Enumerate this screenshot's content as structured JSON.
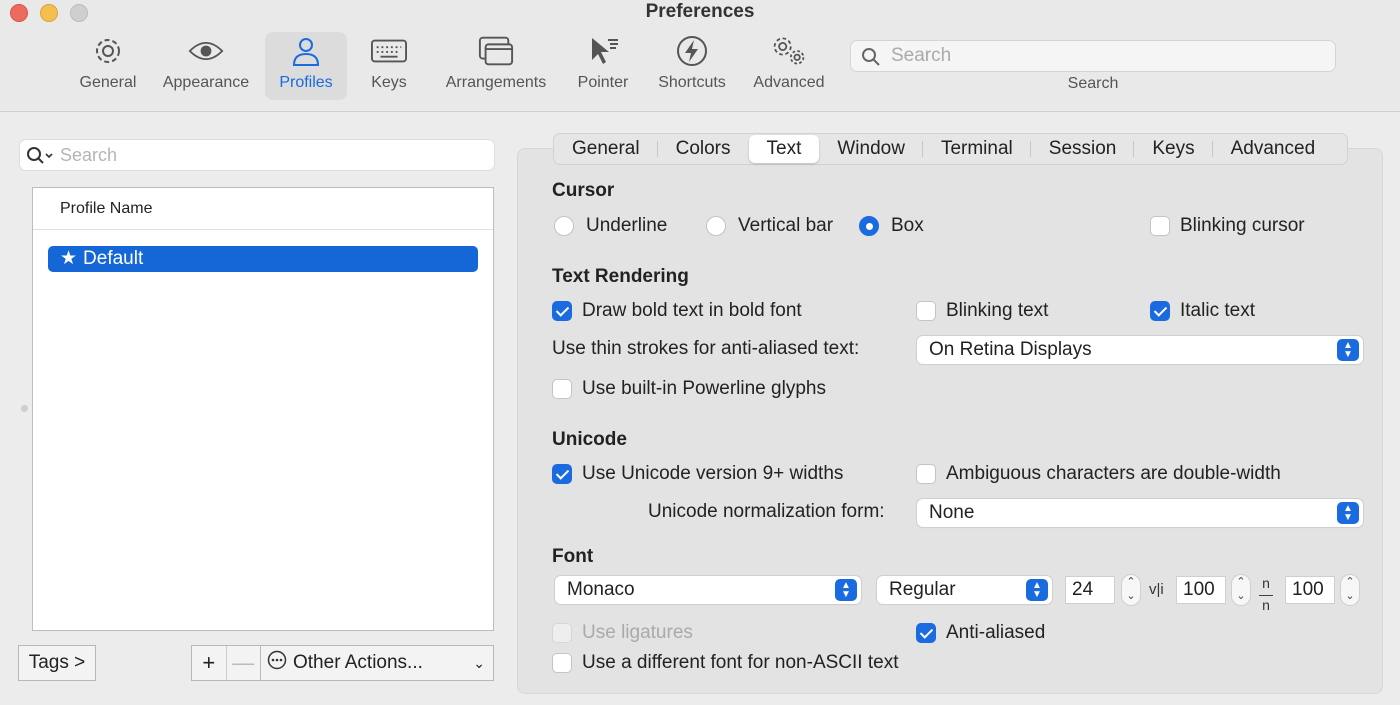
{
  "window": {
    "title": "Preferences"
  },
  "toolbar": {
    "items": [
      {
        "label": "General",
        "icon": "gear-icon"
      },
      {
        "label": "Appearance",
        "icon": "eye-icon"
      },
      {
        "label": "Profiles",
        "icon": "person-icon"
      },
      {
        "label": "Keys",
        "icon": "keyboard-icon"
      },
      {
        "label": "Arrangements",
        "icon": "windows-icon"
      },
      {
        "label": "Pointer",
        "icon": "pointer-icon"
      },
      {
        "label": "Shortcuts",
        "icon": "bolt-icon"
      },
      {
        "label": "Advanced",
        "icon": "gears-icon"
      }
    ],
    "active": "Profiles",
    "search_placeholder": "Search",
    "search_label": "Search"
  },
  "profiles": {
    "search_placeholder": "Search",
    "column_header": "Profile Name",
    "rows": [
      {
        "name": "Default",
        "starred": true
      }
    ],
    "tags_label": "Tags >",
    "add_label": "+",
    "remove_label": "—",
    "other_actions_label": "Other Actions..."
  },
  "tabs": {
    "items": [
      "General",
      "Colors",
      "Text",
      "Window",
      "Terminal",
      "Session",
      "Keys",
      "Advanced"
    ],
    "active": "Text"
  },
  "cursor": {
    "heading": "Cursor",
    "options": [
      "Underline",
      "Vertical bar",
      "Box"
    ],
    "selected": "Box",
    "blinking_label": "Blinking cursor",
    "blinking": false
  },
  "text_rendering": {
    "heading": "Text Rendering",
    "bold_label": "Draw bold text in bold font",
    "bold": true,
    "blinking_text_label": "Blinking text",
    "blinking_text": false,
    "italic_label": "Italic text",
    "italic": true,
    "thin_strokes_label": "Use thin strokes for anti-aliased text:",
    "thin_strokes_value": "On Retina Displays",
    "powerline_label": "Use built-in Powerline glyphs",
    "powerline": false
  },
  "unicode": {
    "heading": "Unicode",
    "widths_label": "Use Unicode version 9+ widths",
    "widths": true,
    "ambiguous_label": "Ambiguous characters are double-width",
    "ambiguous": false,
    "normalization_label": "Unicode normalization form:",
    "normalization_value": "None"
  },
  "font": {
    "heading": "Font",
    "family": "Monaco",
    "style": "Regular",
    "size": "24",
    "h_spacing_symbol": "v|i",
    "h_spacing": "100",
    "v_spacing_symbol": "n/n",
    "v_spacing": "100",
    "ligatures_label": "Use ligatures",
    "ligatures": false,
    "antialiased_label": "Anti-aliased",
    "antialiased": true,
    "nonascii_label": "Use a different font for non-ASCII text",
    "nonascii": false
  },
  "colors": {
    "accent": "#1a6ae0",
    "selection": "#1566d6"
  }
}
